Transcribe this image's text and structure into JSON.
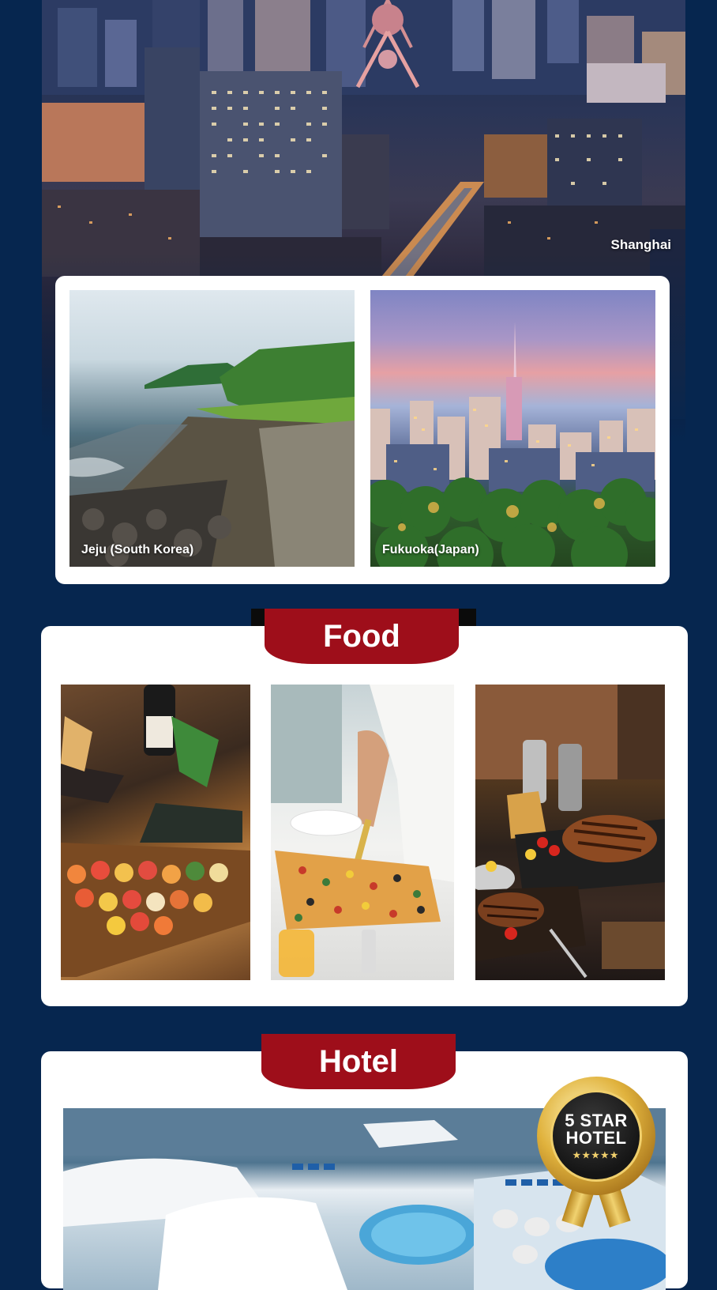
{
  "hero": {
    "city_label": "Shanghai"
  },
  "destinations": [
    {
      "label": "Jeju (South Korea)"
    },
    {
      "label": "Fukuoka(Japan)"
    }
  ],
  "food": {
    "title": "Food"
  },
  "hotel": {
    "title": "Hotel",
    "badge_line1": "5 STAR",
    "badge_line2": "HOTEL",
    "badge_stars": "★★★★★"
  },
  "colors": {
    "page_background": "#06264f",
    "banner_red": "#9e0e1a",
    "badge_gold": "#e0b23d"
  }
}
